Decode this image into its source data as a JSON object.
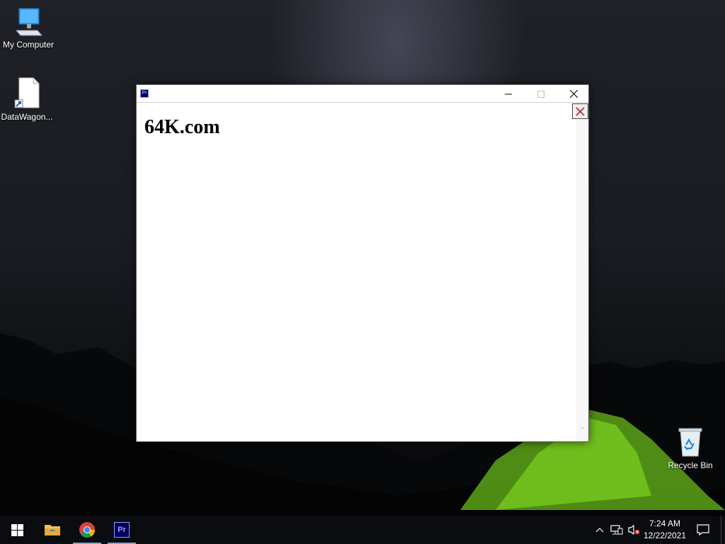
{
  "desktop": {
    "icons": [
      {
        "label": "My Computer",
        "icon": "monitor-icon"
      },
      {
        "label": "DataWagon...",
        "icon": "file-shortcut-icon"
      },
      {
        "label": "Recycle Bin",
        "icon": "recycle-bin-icon"
      }
    ]
  },
  "window": {
    "app_icon_text": "Pr",
    "controls": {
      "minimize": "minimize-icon",
      "maximize": "maximize-icon",
      "close": "close-icon"
    },
    "content": {
      "headline": "64K.com"
    }
  },
  "taskbar": {
    "start": "windows-start-icon",
    "pinned": [
      {
        "name": "File Explorer",
        "icon": "folder-icon"
      },
      {
        "name": "Google Chrome",
        "icon": "chrome-icon"
      },
      {
        "name": "Premiere Pro",
        "icon": "premiere-icon",
        "text": "Pr"
      }
    ],
    "clock": {
      "time": "7:24 AM",
      "date": "12/22/2021"
    }
  },
  "colors": {
    "accent": "#7aa7d6",
    "premiere_bg": "#00005b",
    "premiere_fg": "#9999ff",
    "close_x": "#c0202a"
  }
}
